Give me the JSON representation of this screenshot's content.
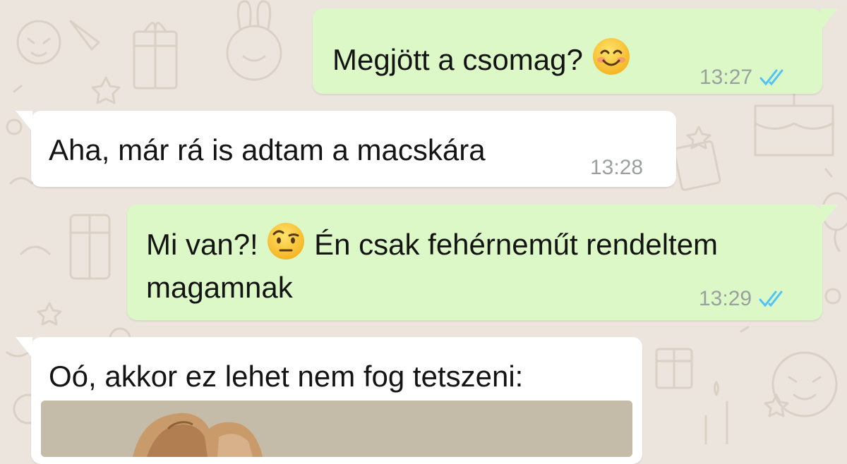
{
  "chat": {
    "messages": [
      {
        "text": "Megjött a csomag?",
        "emoji": "smiling-face-emoji",
        "time": "13:27",
        "direction": "out",
        "read": true
      },
      {
        "text": "Aha, már rá is adtam a macskára",
        "time": "13:28",
        "direction": "in"
      },
      {
        "text_before": "Mi van?!",
        "emoji": "raised-eyebrow-face-emoji",
        "text_after": "Én csak fehérneműt rendeltem magamnak",
        "time": "13:29",
        "direction": "out",
        "read": true
      },
      {
        "text": "Oó, akkor ez lehet nem fog tetszeni:",
        "direction": "in",
        "attachment": "photo"
      }
    ]
  },
  "colors": {
    "wallpaper": "#ece5dd",
    "outgoing_bubble": "#dcf8c6",
    "incoming_bubble": "#ffffff",
    "read_ticks": "#4fc3f7",
    "timestamp": "#9aa0a0"
  }
}
